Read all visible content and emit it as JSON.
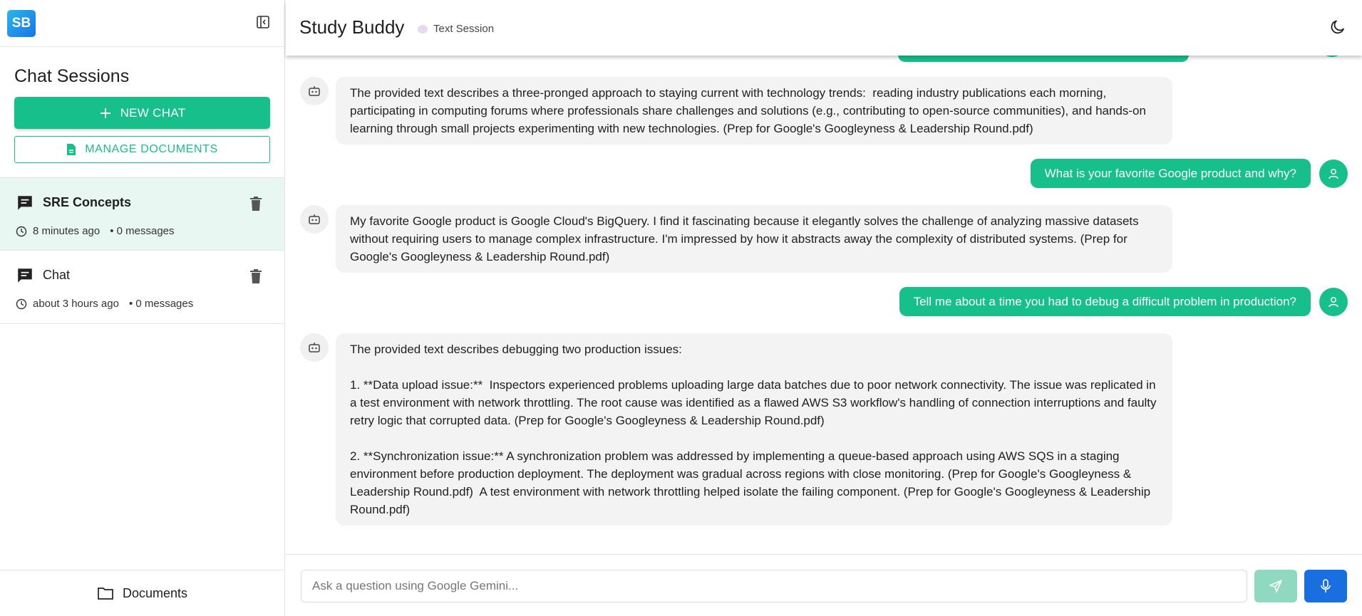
{
  "sidebar": {
    "logo_text": "SB",
    "collapse_icon": "sidebar-collapse-icon",
    "title": "Chat Sessions",
    "new_chat_label": "NEW CHAT",
    "manage_documents_label": "MANAGE DOCUMENTS",
    "sessions": [
      {
        "title": "SRE Concepts",
        "time": "8 minutes ago",
        "count": "• 0 messages",
        "active": true
      },
      {
        "title": "Chat",
        "time": "about 3 hours ago",
        "count": "• 0 messages",
        "active": false
      }
    ],
    "documents_label": "Documents"
  },
  "header": {
    "title": "Study Buddy",
    "session_type": "Text Session",
    "theme_icon": "moon-icon"
  },
  "messages": [
    {
      "role": "bot",
      "text": "The provided text describes a three-pronged approach to staying current with technology trends:  reading industry publications each morning, participating in computing forums where professionals share challenges and solutions (e.g., contributing to open-source communities), and hands-on learning through small projects experimenting with new technologies. (Prep for Google's Googleyness & Leadership Round.pdf)"
    },
    {
      "role": "user",
      "text": "What is your favorite Google product and why?"
    },
    {
      "role": "bot",
      "text": "My favorite Google product is Google Cloud's BigQuery. I find it fascinating because it elegantly solves the challenge of analyzing massive datasets without requiring users to manage complex infrastructure. I'm impressed by how it abstracts away the complexity of distributed systems. (Prep for Google's Googleyness & Leadership Round.pdf)"
    },
    {
      "role": "user",
      "text": "Tell me about a time you had to debug a difficult problem in production?"
    },
    {
      "role": "bot",
      "text": "The provided text describes debugging two production issues:\n\n1. **Data upload issue:**  Inspectors experienced problems uploading large data batches due to poor network connectivity. The issue was replicated in a test environment with network throttling. The root cause was identified as a flawed AWS S3 workflow's handling of connection interruptions and faulty retry logic that corrupted data. (Prep for Google's Googleyness & Leadership Round.pdf)\n\n2. **Synchronization issue:** A synchronization problem was addressed by implementing a queue-based approach using AWS SQS in a staging environment before production deployment. The deployment was gradual across regions with close monitoring. (Prep for Google's Googleyness & Leadership Round.pdf)  A test environment with network throttling helped isolate the failing component. (Prep for Google's Googleyness & Leadership Round.pdf)"
    }
  ],
  "composer": {
    "placeholder": "Ask a question using Google Gemini...",
    "send_icon": "send-icon",
    "mic_icon": "microphone-icon"
  },
  "colors": {
    "accent": "#17c08a",
    "mic": "#1a6fe0",
    "send_disabled": "#8fd9c1"
  }
}
